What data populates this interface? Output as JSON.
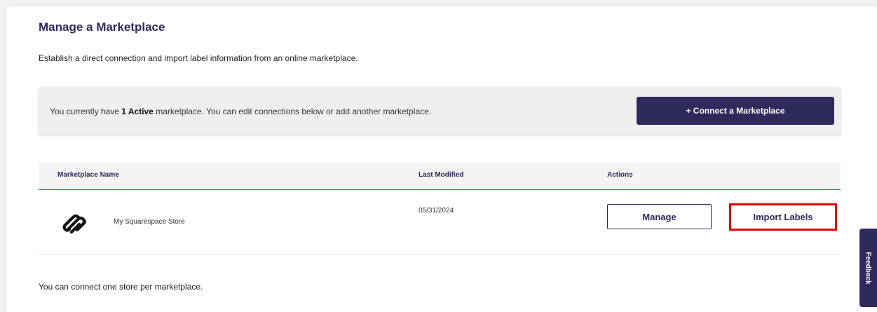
{
  "page": {
    "title": "Manage a Marketplace",
    "subtitle": "Establish a direct connection and import label information from an online marketplace."
  },
  "status_banner": {
    "text_prefix": "You currently have ",
    "active_count_label": "1 Active",
    "text_suffix": " marketplace. You can edit connections below or add another marketplace.",
    "connect_button_label": "+ Connect a Marketplace"
  },
  "table": {
    "headers": {
      "name": "Marketplace Name",
      "last_modified": "Last Modified",
      "actions": "Actions"
    },
    "rows": [
      {
        "logo_icon": "squarespace-logo-icon",
        "name": "My Squarespace Store",
        "last_modified": "05/31/2024",
        "manage_label": "Manage",
        "import_label": "Import Labels"
      }
    ]
  },
  "footnote": "You can connect one store per marketplace.",
  "feedback_tab": {
    "label": "Feedback"
  },
  "colors": {
    "brand_navy": "#2e2a5c",
    "header_divider_red": "#d93434",
    "highlight_red": "#e10000"
  }
}
